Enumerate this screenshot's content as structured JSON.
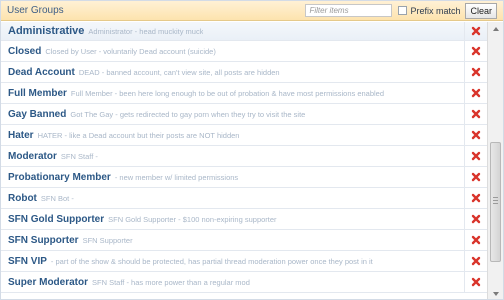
{
  "header": {
    "title": "User Groups",
    "filter_placeholder": "Filter items",
    "prefix_label": "Prefix match",
    "clear_label": "Clear"
  },
  "groups": [
    {
      "name": "Administrative",
      "desc": "Administrator - head muckity muck"
    },
    {
      "name": "Closed",
      "desc": "Closed by User - voluntarily Dead account (suicide)"
    },
    {
      "name": "Dead Account",
      "desc": "DEAD - banned account, can't view site, all posts are hidden"
    },
    {
      "name": "Full Member",
      "desc": "Full Member - been here long enough to be out of probation & have most permissions enabled"
    },
    {
      "name": "Gay Banned",
      "desc": "Got The Gay - gets redirected to gay porn when they try to visit the site"
    },
    {
      "name": "Hater",
      "desc": "HATER - like a Dead account but their posts are NOT hidden"
    },
    {
      "name": "Moderator",
      "desc": "SFN Staff -"
    },
    {
      "name": "Probationary Member",
      "desc": "- new member w/ limited permissions"
    },
    {
      "name": "Robot",
      "desc": "SFN Bot -"
    },
    {
      "name": "SFN Gold Supporter",
      "desc": "SFN Gold Supporter - $100 non-expiring supporter"
    },
    {
      "name": "SFN Supporter",
      "desc": "SFN Supporter"
    },
    {
      "name": "SFN VIP",
      "desc": "- part of the show & should be protected, has partial thread moderation power once they post in it"
    },
    {
      "name": "Super Moderator",
      "desc": "SFN Staff - has more power than a regular mod"
    }
  ]
}
